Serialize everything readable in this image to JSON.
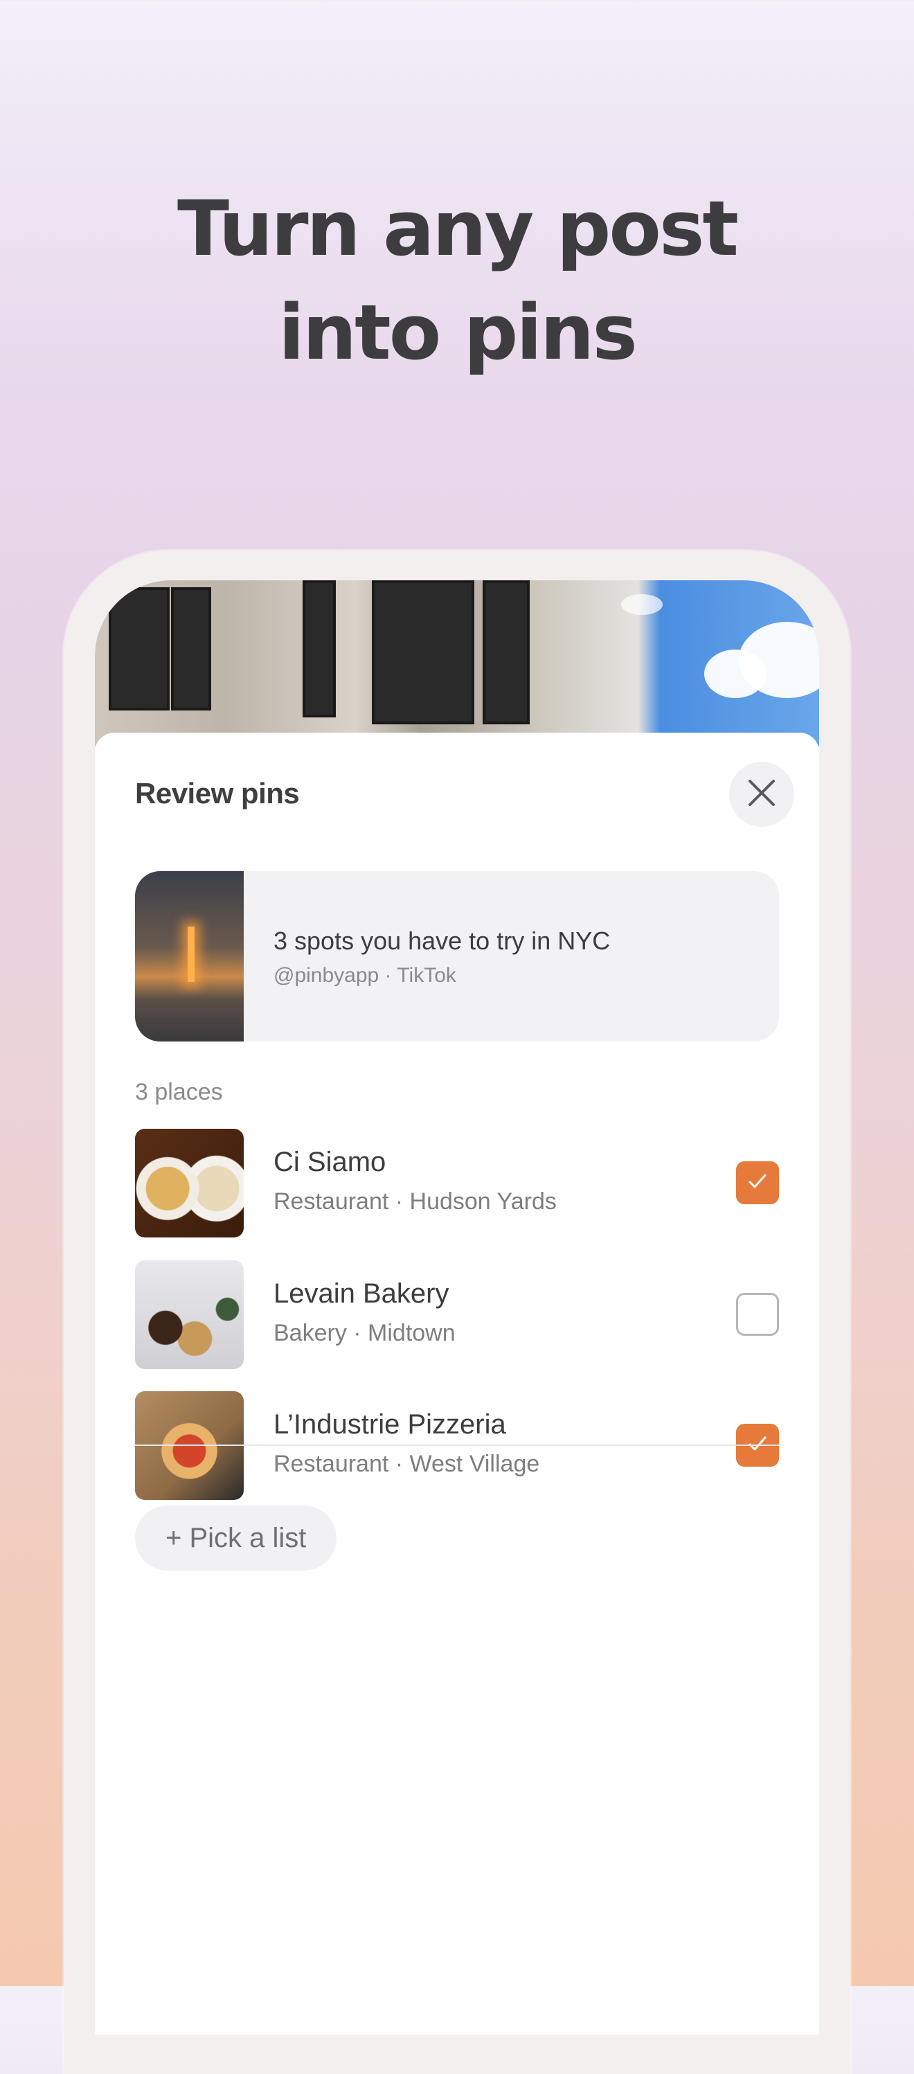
{
  "headline": {
    "line1": "Turn any post",
    "line2": "into pins"
  },
  "sheet": {
    "title": "Review pins",
    "close_icon": "close-icon"
  },
  "post": {
    "title": "3 spots you have to try in NYC",
    "subtitle": "@pinbyapp · TikTok"
  },
  "places_label": "3 places",
  "places": [
    {
      "name": "Ci Siamo",
      "meta": "Restaurant · Hudson Yards",
      "checked": true
    },
    {
      "name": "Levain Bakery",
      "meta": "Bakery · Midtown",
      "checked": false
    },
    {
      "name": "L’Industrie Pizzeria",
      "meta": "Restaurant · West Village",
      "checked": true
    }
  ],
  "pick_list_label": "+ Pick a list",
  "colors": {
    "accent": "#e57a3a",
    "text": "#3d3d40",
    "muted": "#8a8a8e"
  }
}
